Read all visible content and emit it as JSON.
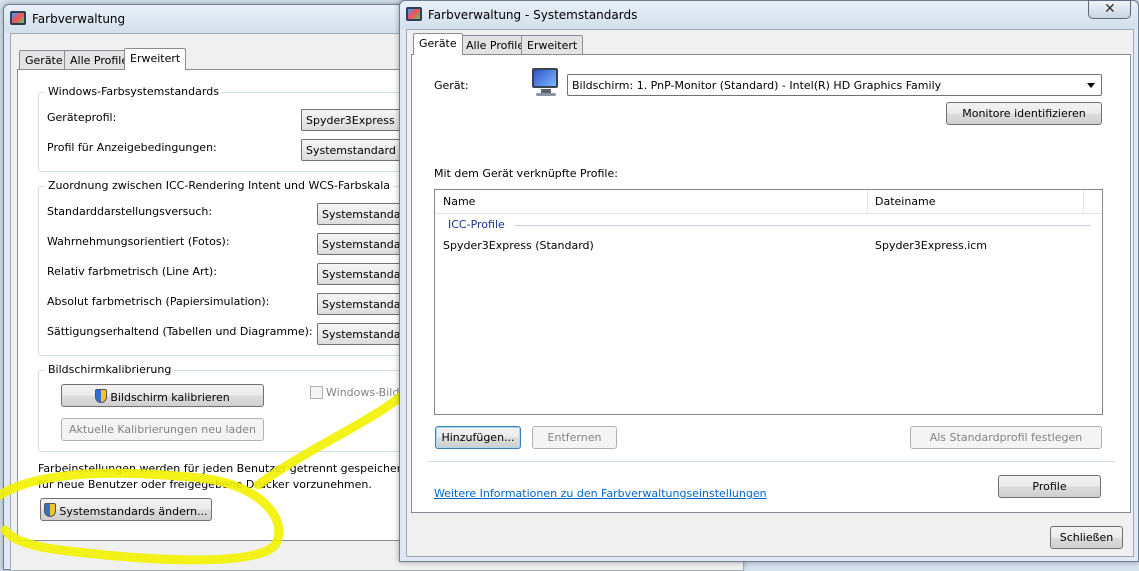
{
  "left_window": {
    "title": "Farbverwaltung",
    "tabs": [
      "Geräte",
      "Alle Profile",
      "Erweitert"
    ],
    "active_tab": "Erweitert",
    "group_defaults": {
      "title": "Windows-Farbsystemstandards",
      "rows": [
        {
          "label": "Geräteprofil:",
          "value": "Spyder3Express"
        },
        {
          "label": "Profil für Anzeigebedingungen:",
          "value": "Systemstandard (W"
        }
      ]
    },
    "group_mapping": {
      "title": "Zuordnung zwischen ICC-Rendering Intent und WCS-Farbskala",
      "rows": [
        {
          "label": "Standarddarstellungsversuch:",
          "value": "Systemstandard"
        },
        {
          "label": "Wahrnehmungsorientiert (Fotos):",
          "value": "Systemstandard"
        },
        {
          "label": "Relativ farbmetrisch (Line Art):",
          "value": "Systemstandard"
        },
        {
          "label": "Absolut farbmetrisch (Papiersimulation):",
          "value": "Systemstandard"
        },
        {
          "label": "Sättigungserhaltend (Tabellen und Diagramme):",
          "value": "Systemstandard"
        }
      ]
    },
    "group_calibration": {
      "title": "Bildschirmkalibrierung",
      "calibrate_button": "Bildschirm kalibrieren",
      "reload_button": "Aktuelle Kalibrierungen neu laden",
      "checkbox_label": "Windows-Bild"
    },
    "footer_text_1": "Farbeinstellungen werden für jeden Benutzer getrennt gespeichert. K",
    "footer_text_2": "für neue Benutzer oder freigegebene Drucker vorzunehmen.",
    "change_defaults_button": "Systemstandards ändern..."
  },
  "right_window": {
    "title": "Farbverwaltung - Systemstandards",
    "tabs": [
      "Geräte",
      "Alle Profile",
      "Erweitert"
    ],
    "active_tab": "Geräte",
    "device_label": "Gerät:",
    "device_value": "Bildschirm: 1. PnP-Monitor (Standard) - Intel(R) HD Graphics Family",
    "identify_button": "Monitore identifizieren",
    "profiles_label": "Mit dem Gerät verknüpfte Profile:",
    "columns": [
      "Name",
      "Dateiname"
    ],
    "group_name": "ICC-Profile",
    "rows": [
      {
        "name": "Spyder3Express (Standard)",
        "file": "Spyder3Express.icm"
      }
    ],
    "add_button": "Hinzufügen...",
    "remove_button": "Entfernen",
    "set_default_button": "Als Standardprofil festlegen",
    "info_link": "Weitere Informationen zu den Farbverwaltungseinstellungen",
    "profile_button": "Profile",
    "close_button": "Schließen"
  },
  "annotation": {
    "color": "#f2f200"
  }
}
